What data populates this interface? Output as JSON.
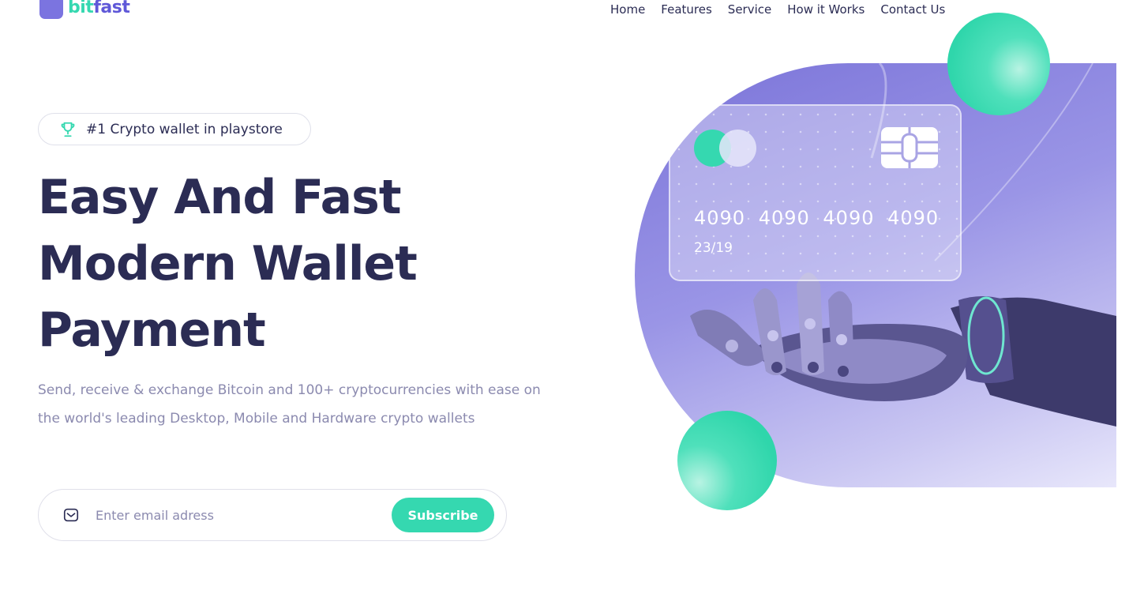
{
  "brand": {
    "name_part1": "bit",
    "name_part2": "fast",
    "accent_color": "#35d8b0",
    "primary_color": "#5f58d8"
  },
  "nav": {
    "items": [
      {
        "label": "Home"
      },
      {
        "label": "Features"
      },
      {
        "label": "Service"
      },
      {
        "label": "How it Works"
      },
      {
        "label": "Contact Us"
      }
    ]
  },
  "hero": {
    "badge": {
      "icon": "trophy-icon",
      "text": "#1 Crypto wallet in playstore"
    },
    "headline": [
      "Easy And Fast",
      "Modern Wallet",
      "Payment"
    ],
    "description": "Send, receive & exchange Bitcoin and 100+ cryptocurrencies with ease on the world's leading Desktop, Mobile and Hardware crypto wallets"
  },
  "subscribe": {
    "icon": "mail-icon",
    "placeholder": "Enter email adress",
    "value": "",
    "button_label": "Subscribe"
  },
  "card": {
    "number": "4090 4090 4090 4090",
    "expiry": "23/19"
  }
}
